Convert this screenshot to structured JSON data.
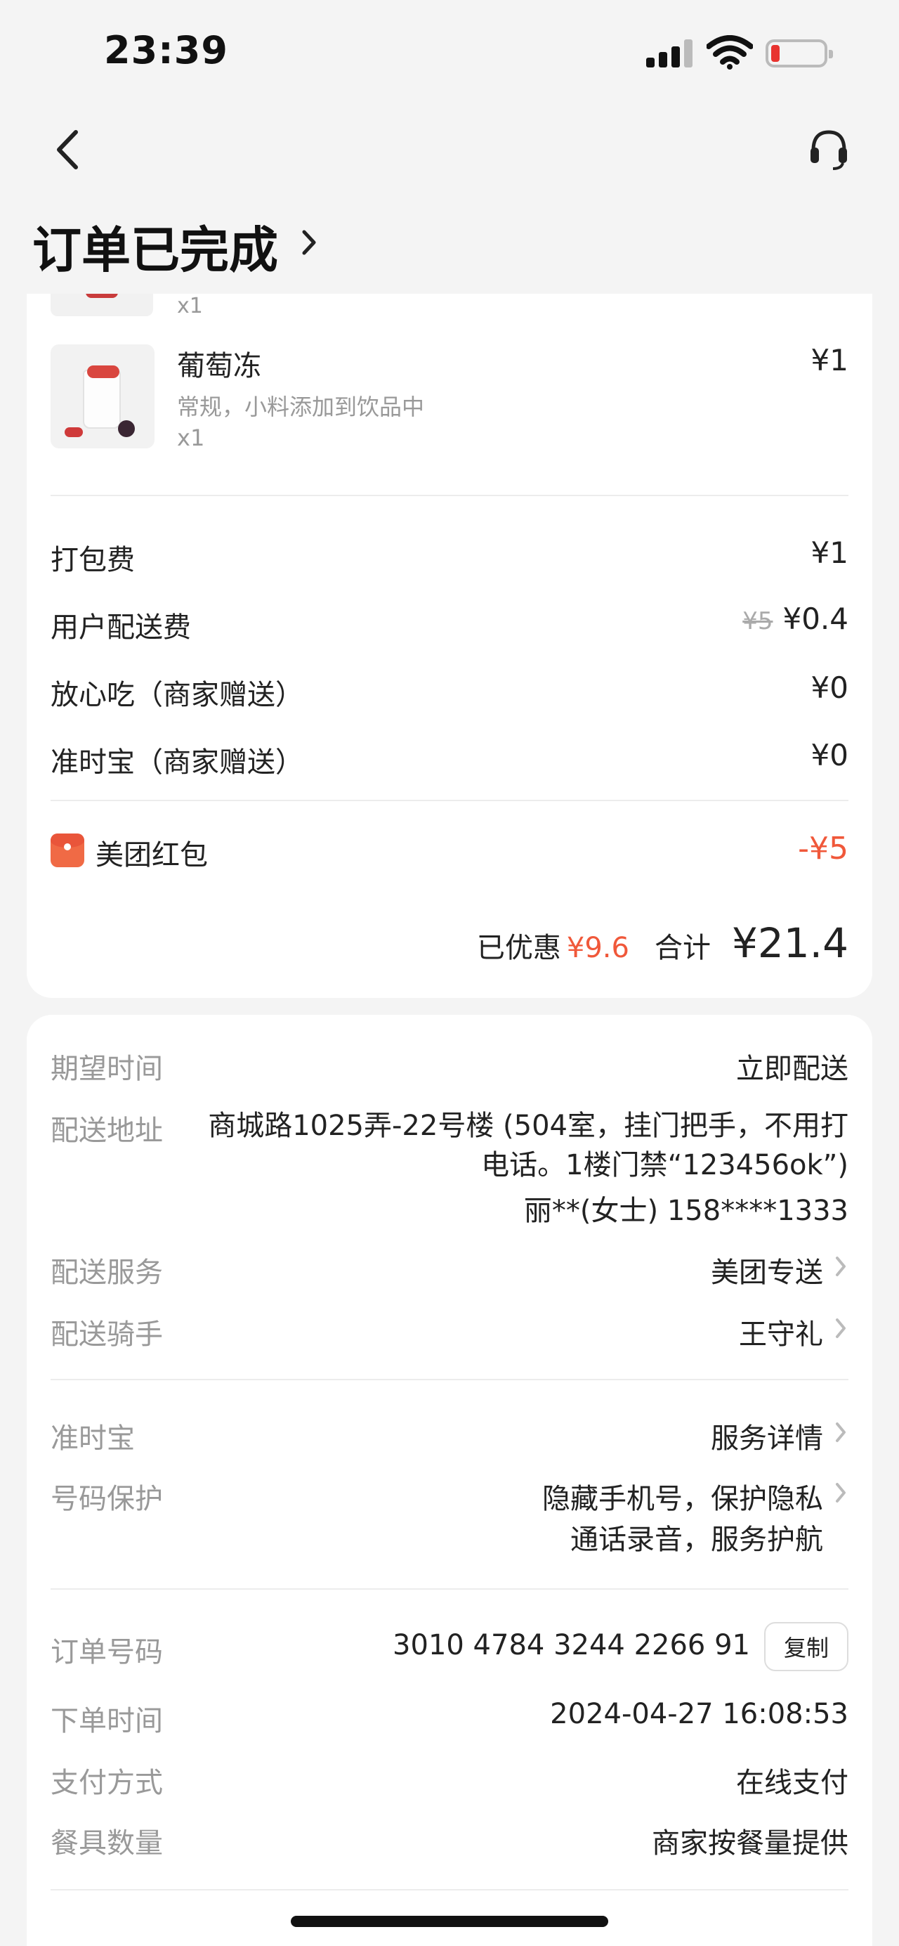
{
  "status_bar": {
    "time": "23:39"
  },
  "header": {
    "title": "订单已完成"
  },
  "order_items": [
    {
      "qty": "x1"
    },
    {
      "name": "葡萄冻",
      "spec": "常规，小料添加到饮品中",
      "qty": "x1",
      "price": "¥1"
    }
  ],
  "fees": [
    {
      "label": "打包费",
      "value": "¥1"
    },
    {
      "label": "用户配送费",
      "original": "¥5",
      "value": "¥0.4"
    },
    {
      "label": "放心吃（商家赠送）",
      "value": "¥0"
    },
    {
      "label": "准时宝（商家赠送）",
      "value": "¥0"
    }
  ],
  "red_packet": {
    "label": "美团红包",
    "value": "-¥5"
  },
  "summary": {
    "discount_label": "已优惠",
    "discount": "¥9.6",
    "total_label": "合计",
    "total": "¥21.4"
  },
  "delivery": {
    "expected_time_label": "期望时间",
    "expected_time": "立即配送",
    "address_label": "配送地址",
    "address": "商城路1025弄-22号楼 (504室，挂门把手，不用打电话。1楼门禁“123456ok”)",
    "contact": "丽**(女士) 158****1333",
    "service_label": "配送服务",
    "service": "美团专送",
    "rider_label": "配送骑手",
    "rider": "王守礼"
  },
  "guarantee": {
    "ontime_label": "准时宝",
    "ontime_value": "服务详情",
    "privacy_label": "号码保护",
    "privacy_line1": "隐藏手机号，保护隐私",
    "privacy_line2": "通话录音，服务护航"
  },
  "order_info": {
    "number_label": "订单号码",
    "number": "3010 4784 3244 2266 91",
    "copy_label": "复制",
    "time_label": "下单时间",
    "time": "2024-04-27 16:08:53",
    "payment_label": "支付方式",
    "payment": "在线支付",
    "utensils_label": "餐具数量",
    "utensils": "商家按餐量提供"
  },
  "colors": {
    "accent": "#f0583a",
    "background": "#f4f4f4",
    "secondary_text": "#999999"
  }
}
